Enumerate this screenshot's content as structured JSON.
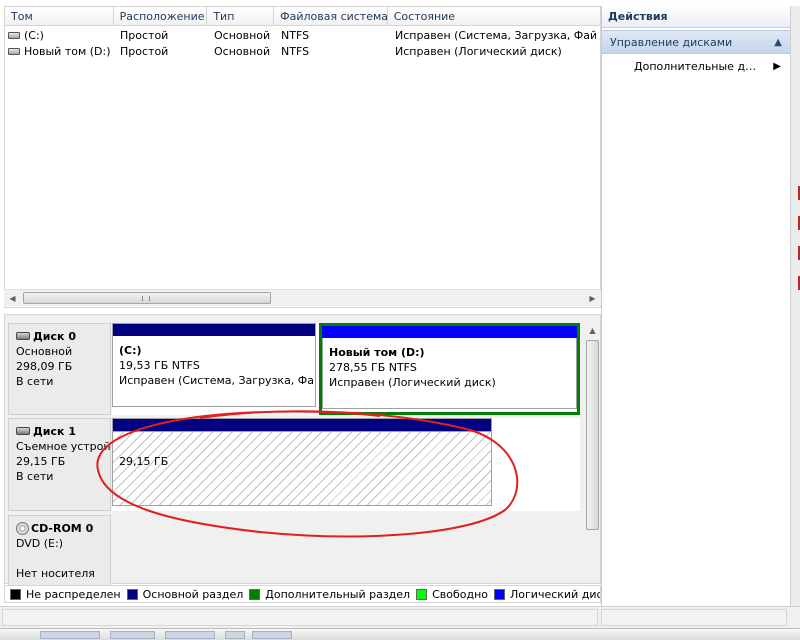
{
  "volumes_table": {
    "columns": [
      "Том",
      "Расположение",
      "Тип",
      "Файловая система",
      "Состояние"
    ],
    "rows": [
      {
        "name": "(C:)",
        "layout": "Простой",
        "type": "Основной",
        "fs": "NTFS",
        "status": "Исправен (Система, Загрузка, Файл подкачки, Активен, Аварийный дамп памяти, Основной раздел)"
      },
      {
        "name": "Новый том (D:)",
        "layout": "Простой",
        "type": "Основной",
        "fs": "NTFS",
        "status": "Исправен (Логический диск)"
      }
    ]
  },
  "disks": [
    {
      "name": "Диск 0",
      "type": "Основной",
      "size": "298,09 ГБ",
      "state": "В сети"
    },
    {
      "name": "Диск 1",
      "type": "Съемное устройство",
      "size": "29,15 ГБ",
      "state": "В сети"
    },
    {
      "name": "CD-ROM 0",
      "type": "DVD (E:)",
      "size": "",
      "state": "Нет носителя"
    }
  ],
  "partitions": {
    "c": {
      "title": "(C:)",
      "size": "19,53 ГБ NTFS",
      "status": "Исправен (Система, Загрузка, Файл подкачки, Активен)",
      "bar_color": "#000080"
    },
    "d": {
      "title": "Новый том  (D:)",
      "size": "278,55 ГБ NTFS",
      "status": "Исправен (Логический диск)",
      "bar_color": "#0000ff",
      "frame_color": "#008000"
    },
    "disk1": {
      "size": "29,15 ГБ",
      "bar_color": "#000080"
    }
  },
  "legend": [
    {
      "label": "Не распределен",
      "color": "#000000"
    },
    {
      "label": "Основной раздел",
      "color": "#000080"
    },
    {
      "label": "Дополнительный раздел",
      "color": "#008000"
    },
    {
      "label": "Свободно",
      "color": "#00ff00"
    },
    {
      "label": "Логический диск",
      "color": "#0000ff"
    }
  ],
  "actions": {
    "title": "Действия",
    "group": "Управление дисками",
    "more": "Дополнительные действия"
  },
  "colors": {
    "annotation": "#e02020"
  }
}
